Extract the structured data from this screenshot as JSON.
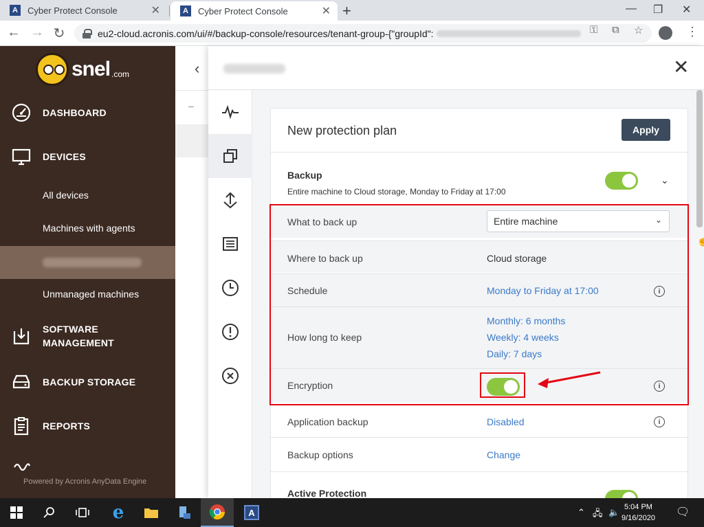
{
  "browser": {
    "tabs": [
      {
        "title": "Cyber Protect Console",
        "favicon": "A"
      },
      {
        "title": "Cyber Protect Console",
        "favicon": "A"
      }
    ],
    "new_tab": "+",
    "url": "eu2-cloud.acronis.com/ui/#/backup-console/resources/tenant-group-{\"groupId\":"
  },
  "sidebar": {
    "brand": "snel",
    "brand_suffix": ".com",
    "items": [
      {
        "label": "DASHBOARD",
        "icon": "dashboard-gauge-icon"
      },
      {
        "label": "DEVICES",
        "icon": "monitor-icon"
      },
      {
        "label": "SOFTWARE\nMANAGEMENT",
        "icon": "software-download-icon"
      },
      {
        "label": "BACKUP STORAGE",
        "icon": "drive-icon"
      },
      {
        "label": "REPORTS",
        "icon": "clipboard-icon"
      }
    ],
    "sub_items": [
      "All devices",
      "Machines with agents",
      "Unmanaged machines"
    ],
    "powered_by": "Powered by Acronis AnyData Engine"
  },
  "panel": {
    "title": "New protection plan",
    "apply_label": "Apply",
    "backup": {
      "title": "Backup",
      "summary": "Entire machine to Cloud storage, Monday to Friday at 17:00",
      "enabled": true
    },
    "rows": {
      "what": {
        "label": "What to back up",
        "value": "Entire machine"
      },
      "where": {
        "label": "Where to back up",
        "value": "Cloud storage"
      },
      "schedule": {
        "label": "Schedule",
        "value": "Monday to Friday at 17:00"
      },
      "retention": {
        "label": "How long to keep",
        "values": [
          "Monthly: 6 months",
          "Weekly: 4 weeks",
          "Daily: 7 days"
        ]
      },
      "encryption": {
        "label": "Encryption",
        "enabled": true
      },
      "app_backup": {
        "label": "Application backup",
        "value": "Disabled"
      },
      "options": {
        "label": "Backup options",
        "value": "Change"
      }
    },
    "active_protection": {
      "title": "Active Protection",
      "enabled": true
    }
  },
  "rail_icons": [
    "activity-pulse-icon",
    "protection-plans-icon",
    "recovery-icon",
    "backups-list-icon",
    "history-clock-icon",
    "alert-icon",
    "stop-icon"
  ],
  "taskbar": {
    "time": "5:04 PM",
    "date": "9/16/2020"
  },
  "colors": {
    "sidebar_bg": "#3b2a22",
    "toggle_on": "#8cc63f",
    "link": "#3a7ac8",
    "annotation_red": "#e30613",
    "apply_bg": "#3b4a5c"
  }
}
